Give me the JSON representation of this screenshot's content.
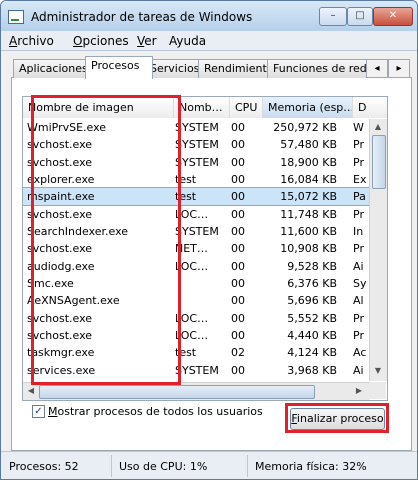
{
  "window": {
    "title": "Administrador de tareas de Windows",
    "minimize_glyph": "–",
    "maximize_glyph": "□",
    "close_glyph": "✕"
  },
  "menu": [
    {
      "key": "A",
      "rest": "rchivo"
    },
    {
      "key": "O",
      "rest": "pciones"
    },
    {
      "key": "V",
      "rest": "er"
    },
    {
      "key": "",
      "rest": "Ayuda"
    }
  ],
  "tabs": [
    "Aplicaciones",
    "Procesos",
    "Servicios",
    "Rendimiento",
    "Funciones de red"
  ],
  "active_tab": "Procesos",
  "tab_scroll": {
    "left": "◂",
    "right": "▸"
  },
  "columns": {
    "name": "Nombre de imagen",
    "user": "Nomb…",
    "cpu": "CPU",
    "memory": "Memoria (esp…",
    "description": "D"
  },
  "processes": [
    {
      "name": "WmiPrvSE.exe",
      "user": "SYSTEM",
      "cpu": "00",
      "memory": "250,972 KB",
      "desc": "W"
    },
    {
      "name": "svchost.exe",
      "user": "SYSTEM",
      "cpu": "00",
      "memory": "57,480 KB",
      "desc": "Pr"
    },
    {
      "name": "svchost.exe",
      "user": "SYSTEM",
      "cpu": "00",
      "memory": "18,900 KB",
      "desc": "Pr"
    },
    {
      "name": "explorer.exe",
      "user": "test",
      "cpu": "00",
      "memory": "16,084 KB",
      "desc": "Ex"
    },
    {
      "name": "mspaint.exe",
      "user": "test",
      "cpu": "00",
      "memory": "15,072 KB",
      "desc": "Pa"
    },
    {
      "name": "svchost.exe",
      "user": "LOC…",
      "cpu": "00",
      "memory": "11,748 KB",
      "desc": "Pr"
    },
    {
      "name": "SearchIndexer.exe",
      "user": "SYSTEM",
      "cpu": "00",
      "memory": "11,600 KB",
      "desc": "In"
    },
    {
      "name": "svchost.exe",
      "user": "NET…",
      "cpu": "00",
      "memory": "10,908 KB",
      "desc": "Pr"
    },
    {
      "name": "audiodg.exe",
      "user": "LOC…",
      "cpu": "00",
      "memory": "9,528 KB",
      "desc": "Ai"
    },
    {
      "name": "Smc.exe",
      "user": "",
      "cpu": "00",
      "memory": "6,376 KB",
      "desc": "Sy"
    },
    {
      "name": "AeXNSAgent.exe",
      "user": "",
      "cpu": "00",
      "memory": "5,696 KB",
      "desc": "Al"
    },
    {
      "name": "svchost.exe",
      "user": "LOC…",
      "cpu": "00",
      "memory": "5,552 KB",
      "desc": "Pr"
    },
    {
      "name": "svchost.exe",
      "user": "LOC…",
      "cpu": "00",
      "memory": "4,440 KB",
      "desc": "Pr"
    },
    {
      "name": "taskmgr.exe",
      "user": "test",
      "cpu": "02",
      "memory": "4,124 KB",
      "desc": "Ac"
    },
    {
      "name": "services.exe",
      "user": "SYSTEM",
      "cpu": "00",
      "memory": "3,968 KB",
      "desc": "Ai"
    }
  ],
  "selected_process": "mspaint.exe",
  "scroll_glyphs": {
    "up": "▲",
    "down": "▼",
    "left": "◀",
    "right": "▶"
  },
  "show_all_users": {
    "checked": true,
    "check_glyph": "✓",
    "key": "M",
    "rest": "ostrar procesos de todos los usuarios"
  },
  "end_process": {
    "key": "F",
    "rest": "inalizar proceso"
  },
  "status": {
    "processes": "Procesos: 52",
    "cpu": "Uso de CPU: 1%",
    "memory": "Memoria física: 32%"
  },
  "highlight_color": "#e0202a",
  "selection_color": "#cce4f7"
}
